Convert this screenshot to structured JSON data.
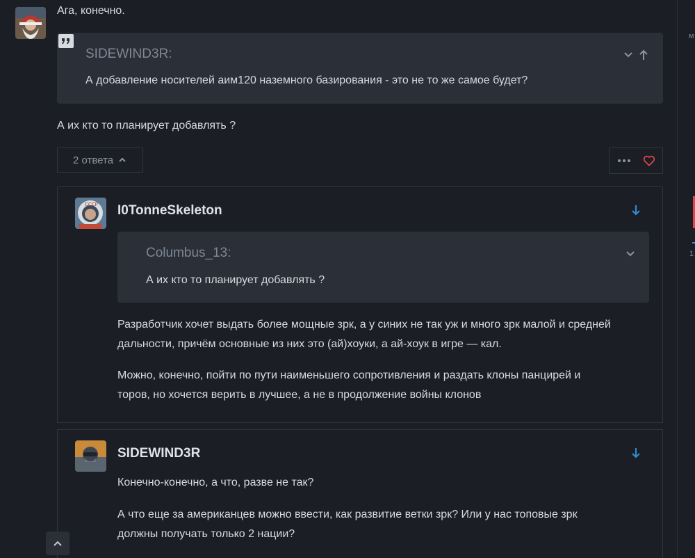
{
  "post": {
    "author_avatar": "santa-avatar",
    "first_line": "Ага, конечно.",
    "quote": {
      "author": "SIDEWIND3R:",
      "text": "А добавление носителей аим120 наземного базирования - это не то же самое будет?"
    },
    "body": "А их кто то планирует добавлять ?",
    "replies_label": "2 ответа"
  },
  "replies": [
    {
      "username": "I0TonneSkeleton",
      "avatar": "cosmonaut-avatar",
      "quote": {
        "author": "Columbus_13:",
        "text": "А их кто то планирует добавлять ?"
      },
      "paragraphs": [
        [
          "Разработчик хочет выдать более мощные зрк, а у синих не так уж и много зрк малой и средней",
          "дальности, причём основные из них это (ай)хоуки, а ай-хоук в игре — кал."
        ],
        [
          "Можно, конечно, пойти по пути наименьшего сопротивления и раздать клоны панцирей и",
          "торов, но хочется верить в лучшее, а не в продолжение войны клонов"
        ]
      ]
    },
    {
      "username": "SIDEWIND3R",
      "avatar": "pilot-avatar",
      "paragraphs": [
        [
          "Конечно-конечно, а что, разве не так?"
        ],
        [
          "А что еще за американцев можно ввести, как развитие ветки зрк? Или у нас топовые зрк",
          "должны получать только 2 нации?"
        ]
      ]
    }
  ],
  "right_rail": {
    "letter": "м",
    "number": "1"
  },
  "colors": {
    "background": "#1b1e24",
    "quote_background": "#2a2f38",
    "accent_blue": "#2f8fd6",
    "heart_red": "#e0474c",
    "muted_text": "#7e8894"
  }
}
